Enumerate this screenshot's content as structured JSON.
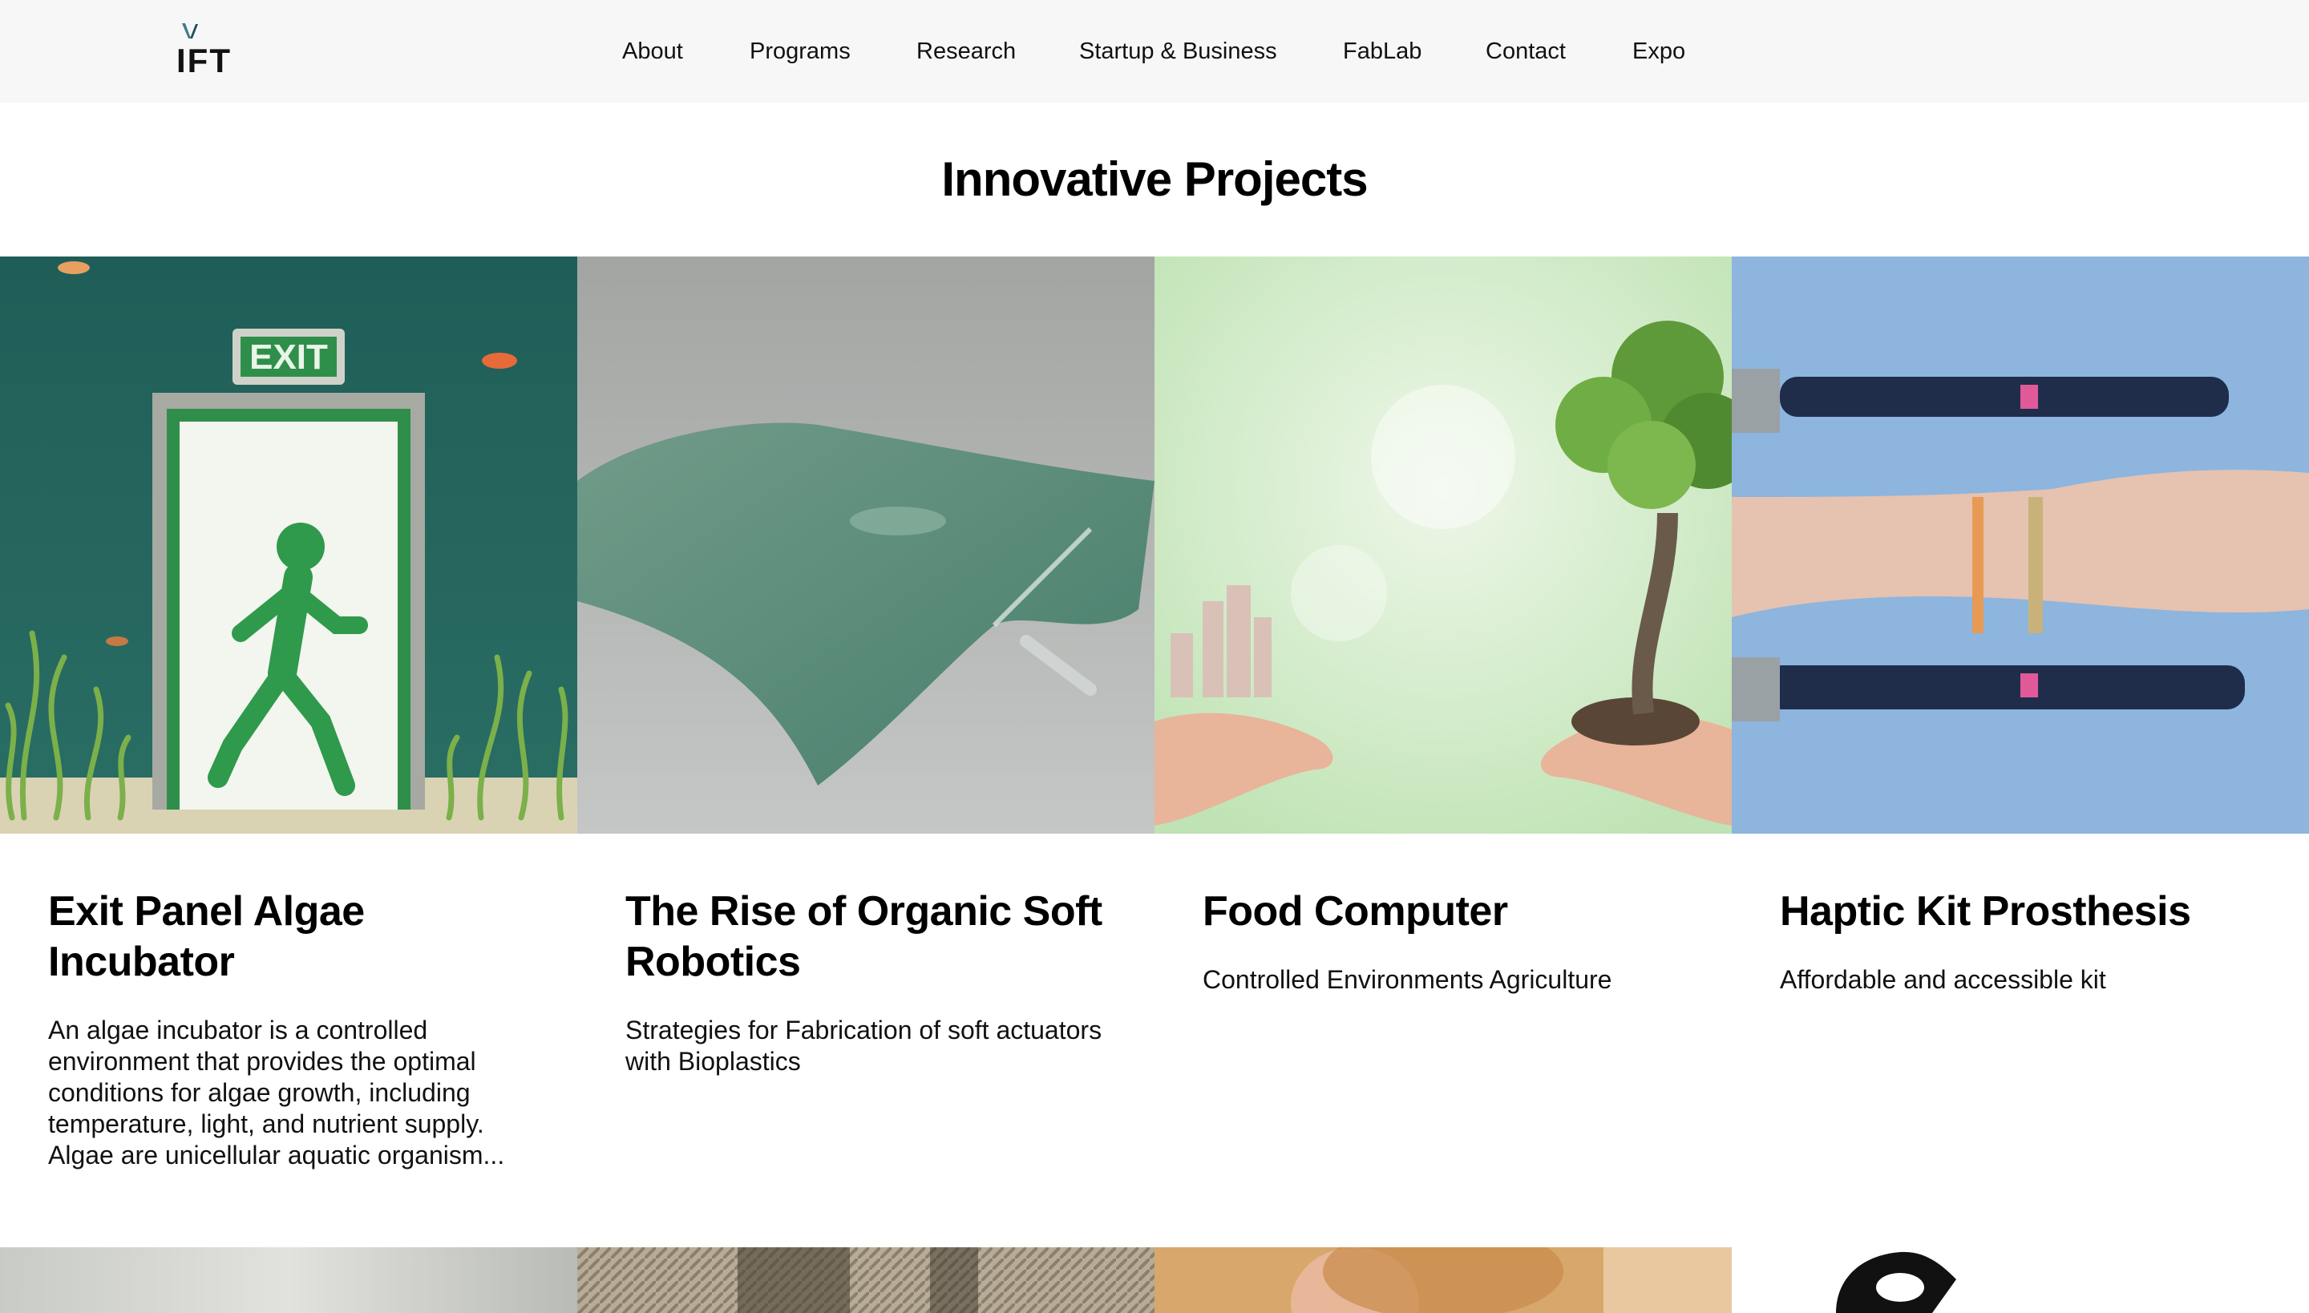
{
  "header": {
    "logo_text": "IFT",
    "nav": [
      "About",
      "Programs",
      "Research",
      "Startup & Business",
      "FabLab",
      "Contact",
      "Expo"
    ]
  },
  "section": {
    "title": "Innovative Projects"
  },
  "projects": [
    {
      "title": "Exit Panel Algae Incubator",
      "description": "An algae incubator is a controlled environment that provides the optimal conditions for algae growth, including temperature, light, and nutrient supply. Algae are unicellular aquatic organism...",
      "image_sign_text": "EXIT"
    },
    {
      "title": "The Rise of Organic Soft Robotics",
      "description": "Strategies for Fabrication of soft actuators with Bioplastics"
    },
    {
      "title": "Food Computer",
      "description": "Controlled Environments Agriculture"
    },
    {
      "title": "Haptic Kit Prosthesis",
      "description": "Affordable and accessible kit"
    }
  ],
  "colors": {
    "header_bg": "#f7f7f7",
    "logo_accent": "#3a7d8c",
    "text": "#000000"
  }
}
